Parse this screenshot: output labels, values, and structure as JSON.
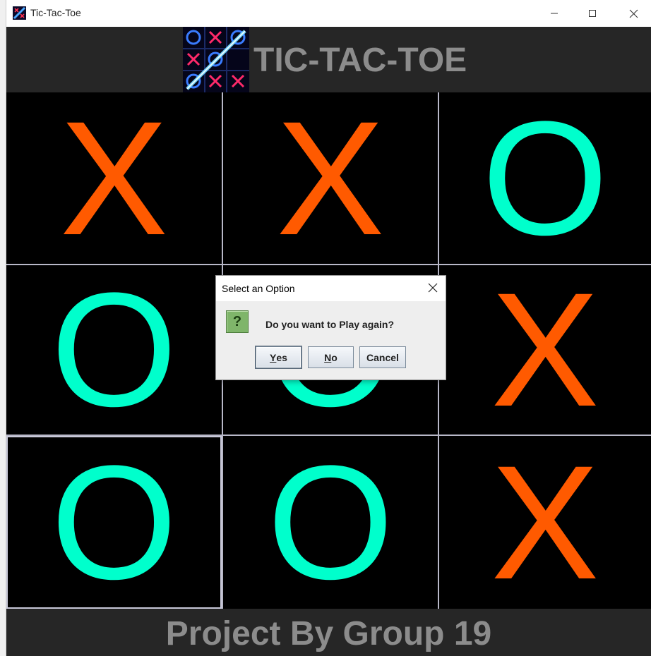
{
  "window": {
    "title": "Tic-Tac-Toe"
  },
  "header": {
    "title": "TIC-TAC-TOE",
    "logo_icon": "tic-tac-toe-logo-icon"
  },
  "board": {
    "cells": [
      {
        "mark": "X",
        "color": "#ff5a00"
      },
      {
        "mark": "X",
        "color": "#ff5a00"
      },
      {
        "mark": "O",
        "color": "#00ffcc"
      },
      {
        "mark": "O",
        "color": "#00ffcc"
      },
      {
        "mark": "O",
        "color": "#00ffcc"
      },
      {
        "mark": "X",
        "color": "#ff5a00"
      },
      {
        "mark": "O",
        "color": "#00ffcc"
      },
      {
        "mark": "O",
        "color": "#00ffcc"
      },
      {
        "mark": "X",
        "color": "#ff5a00"
      }
    ]
  },
  "footer": {
    "text": "Project By Group 19"
  },
  "dialog": {
    "title": "Select an Option",
    "icon": "question-icon",
    "icon_glyph": "?",
    "message": "Do you want to Play again?",
    "buttons": {
      "yes": {
        "mnemonic": "Y",
        "rest": "es"
      },
      "no": {
        "mnemonic": "N",
        "rest": "o"
      },
      "cancel": "Cancel"
    }
  },
  "colors": {
    "x_mark": "#ff5a00",
    "o_mark": "#00ffcc",
    "panel_bg": "#262626",
    "panel_text": "#8c8c8c"
  }
}
